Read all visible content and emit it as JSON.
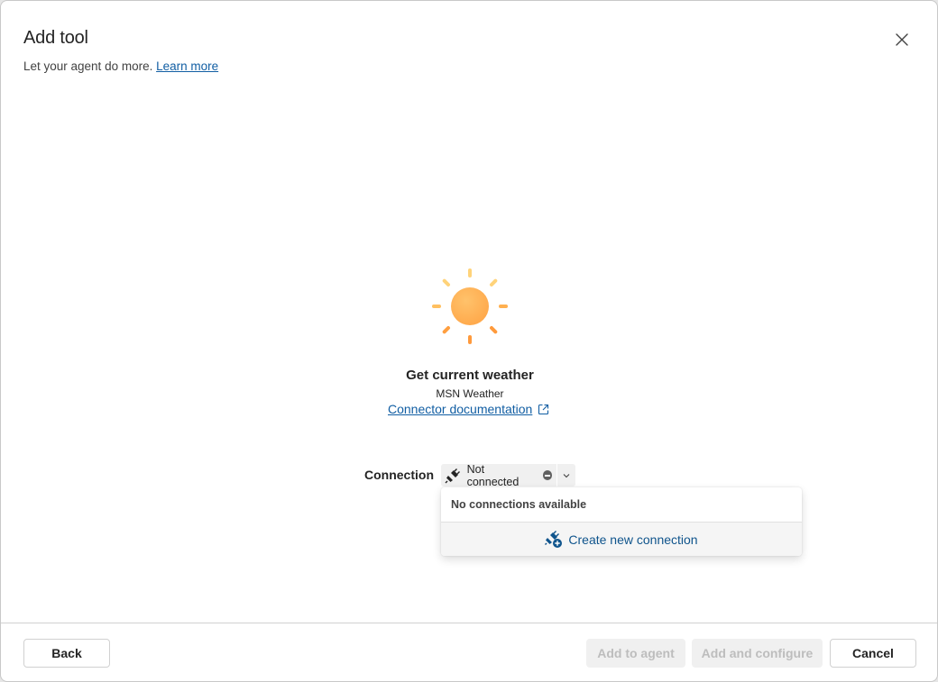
{
  "header": {
    "title": "Add tool",
    "subtitle": "Let your agent do more.",
    "learn_more": "Learn more"
  },
  "tool": {
    "name": "Get current weather",
    "connector": "MSN Weather",
    "doc_link": "Connector documentation",
    "icon": "sun-icon"
  },
  "connection": {
    "label": "Connection",
    "selected": "Not connected",
    "status_icon": "minus-circle-icon",
    "dropdown": {
      "empty_text": "No connections available",
      "create_label": "Create new connection"
    }
  },
  "footer": {
    "back": "Back",
    "add_to_agent": "Add to agent",
    "add_and_configure": "Add and configure",
    "cancel": "Cancel"
  },
  "colors": {
    "link": "#115ea3",
    "sun": "#ffb259",
    "disabled_bg": "#f0f0f0",
    "disabled_text": "#bdbdbd"
  }
}
